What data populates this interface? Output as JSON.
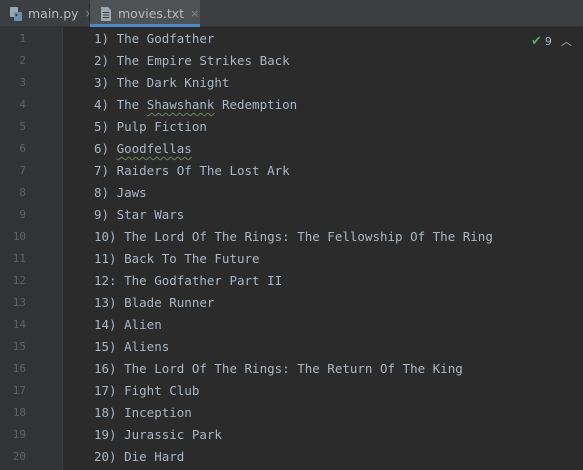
{
  "tabs": [
    {
      "label": "main.py",
      "close": "×",
      "icon": "python-file-icon"
    },
    {
      "label": "movies.txt",
      "close": "×",
      "icon": "text-file-icon"
    }
  ],
  "inspection": {
    "count": "9",
    "icon": "check-icon",
    "collapse_icon": "chevron-up-icon"
  },
  "line_numbers": [
    "1",
    "2",
    "3",
    "4",
    "5",
    "6",
    "7",
    "8",
    "9",
    "10",
    "11",
    "12",
    "13",
    "14",
    "15",
    "16",
    "17",
    "18",
    "19",
    "20"
  ],
  "lines": [
    "1) The Godfather",
    "2) The Empire Strikes Back",
    "3) The Dark Knight",
    "4) The Shawshank Redemption",
    "5) Pulp Fiction",
    "6) Goodfellas",
    "7) Raiders Of The Lost Ark",
    "8) Jaws",
    "9) Star Wars",
    "10) The Lord Of The Rings: The Fellowship Of The Ring",
    "11) Back To The Future",
    "12: The Godfather Part II",
    "13) Blade Runner",
    "14) Alien",
    "15) Aliens",
    "16) The Lord Of The Rings: The Return Of The King",
    "17) Fight Club",
    "18) Inception",
    "19) Jurassic Park",
    "20) Die Hard"
  ],
  "colors": {
    "accent": "#4a88c7",
    "text": "#a9b7c6",
    "gutter_text": "#606366"
  }
}
